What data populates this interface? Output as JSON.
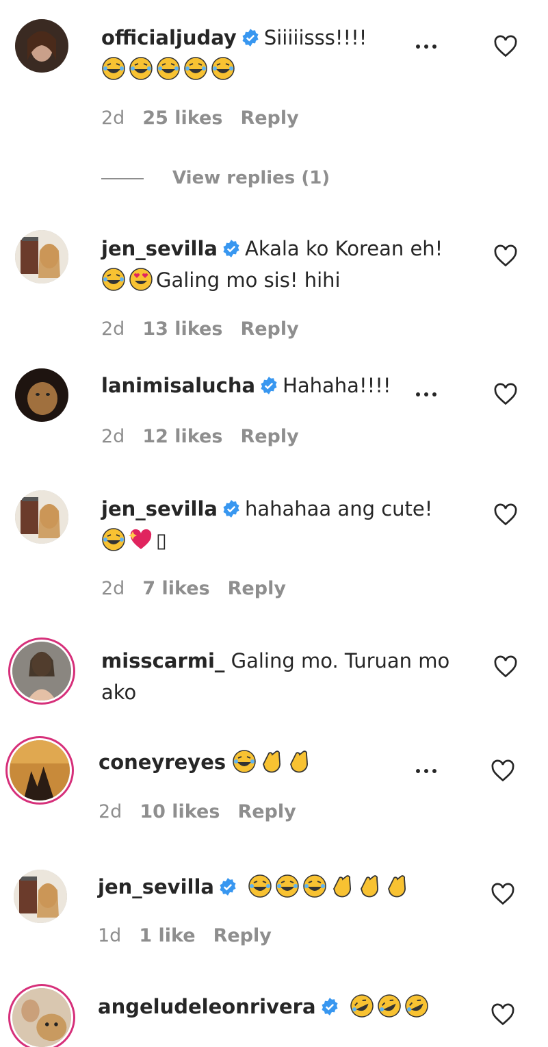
{
  "comments": [
    {
      "username": "officialjuday",
      "verified": true,
      "text": "Siiiiisss!!!!",
      "emojis": [
        "laugh-tears",
        "laugh-tears",
        "laugh-tears",
        "laugh-tears",
        "laugh-tears"
      ],
      "time": "2d",
      "likes": "25 likes",
      "reply": "Reply",
      "view_replies": "View replies (1)"
    },
    {
      "username": "jen_sevilla",
      "verified": true,
      "text": "Akala ko Korean eh!",
      "text2": "Galing mo sis! hihi",
      "emojis": [
        "laugh-tears",
        "heart-eyes"
      ],
      "time": "2d",
      "likes": "13 likes",
      "reply": "Reply"
    },
    {
      "username": "lanimisalucha",
      "verified": true,
      "text": "Hahaha!!!!",
      "time": "2d",
      "likes": "12 likes",
      "reply": "Reply"
    },
    {
      "username": "jen_sevilla",
      "verified": true,
      "text": "hahahaa ang cute!",
      "emojis": [
        "laugh-tears",
        "sparkling-heart"
      ],
      "text2": "▯",
      "time": "2d",
      "likes": "7 likes",
      "reply": "Reply"
    },
    {
      "username": "misscarmi_",
      "verified": false,
      "text": "Galing mo. Turuan mo",
      "text2": "ako"
    },
    {
      "username": "coneyreyes",
      "verified": false,
      "emojis": [
        "laugh-tears",
        "clap",
        "clap"
      ],
      "time": "2d",
      "likes": "10 likes",
      "reply": "Reply"
    },
    {
      "username": "jen_sevilla",
      "verified": true,
      "emojis": [
        "laugh-tears",
        "laugh-tears",
        "laugh-tears",
        "clap",
        "clap",
        "clap"
      ],
      "time": "1d",
      "likes": "1 like",
      "reply": "Reply"
    },
    {
      "username": "angeludeleonrivera",
      "verified": true,
      "emojis": [
        "rofl",
        "rofl",
        "rofl"
      ]
    }
  ],
  "colors": {
    "verified": "#3897f0",
    "muted": "#8e8e8e",
    "story_ring": "#d6307a"
  },
  "icons": {
    "more": "more-icon",
    "heart": "heart-icon",
    "verified": "verified-badge-icon"
  }
}
